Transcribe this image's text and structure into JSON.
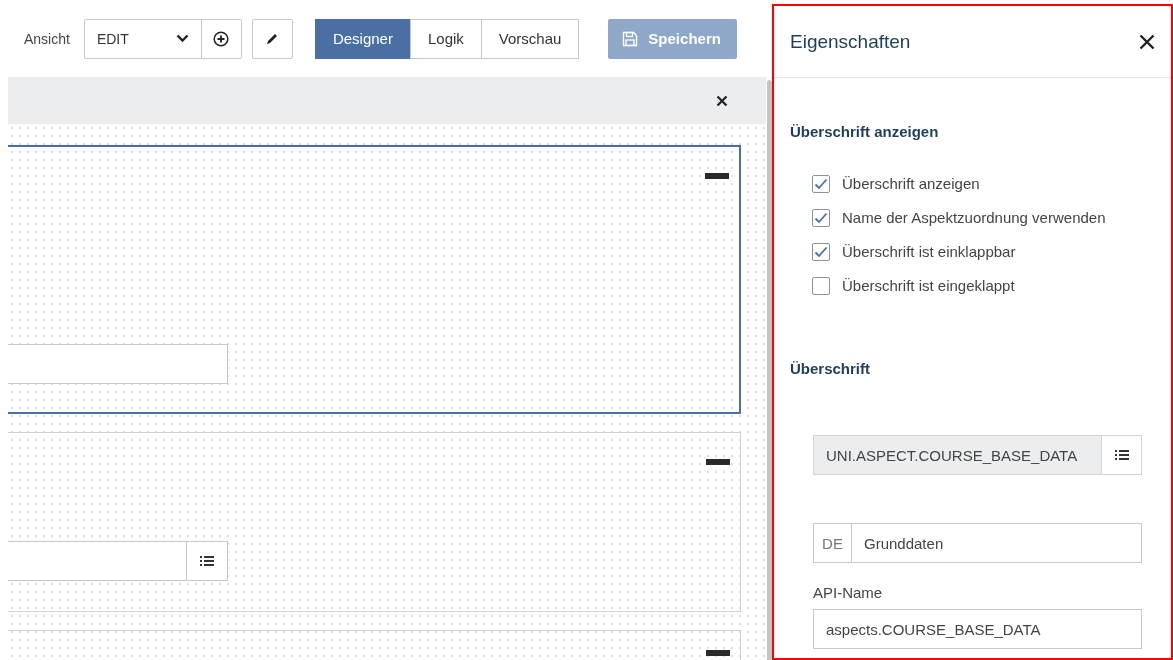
{
  "toolbar": {
    "view_label": "Ansicht",
    "view_select": {
      "value": "EDIT"
    },
    "modes": [
      {
        "label": "Designer",
        "selected": true
      },
      {
        "label": "Logik",
        "selected": false
      },
      {
        "label": "Vorschau",
        "selected": false
      }
    ],
    "save_button": {
      "label": "Speichern",
      "disabled": true
    }
  },
  "canvas": {
    "cards": [
      {
        "selected": true,
        "kind": "text"
      },
      {
        "selected": false,
        "kind": "list"
      },
      {
        "selected": false,
        "kind": "empty"
      }
    ]
  },
  "panel": {
    "title": "Eigenschaften",
    "highlighted": true,
    "display_section": {
      "heading": "Überschrift anzeigen",
      "checkboxes": [
        {
          "label": "Überschrift anzeigen",
          "checked": true
        },
        {
          "label": "Name der Aspektzuordnung verwenden",
          "checked": true
        },
        {
          "label": "Überschrift ist einklappbar",
          "checked": true
        },
        {
          "label": "Überschrift ist eingeklappt",
          "checked": false
        }
      ]
    },
    "heading_section": {
      "heading": "Überschrift",
      "key_field": {
        "value": "UNI.ASPECT.COURSE_BASE_DATA"
      },
      "translation": {
        "language": "DE",
        "value": "Grunddaten"
      },
      "api_name": {
        "label": "API-Name",
        "value": "aspects.COURSE_BASE_DATA"
      }
    }
  }
}
